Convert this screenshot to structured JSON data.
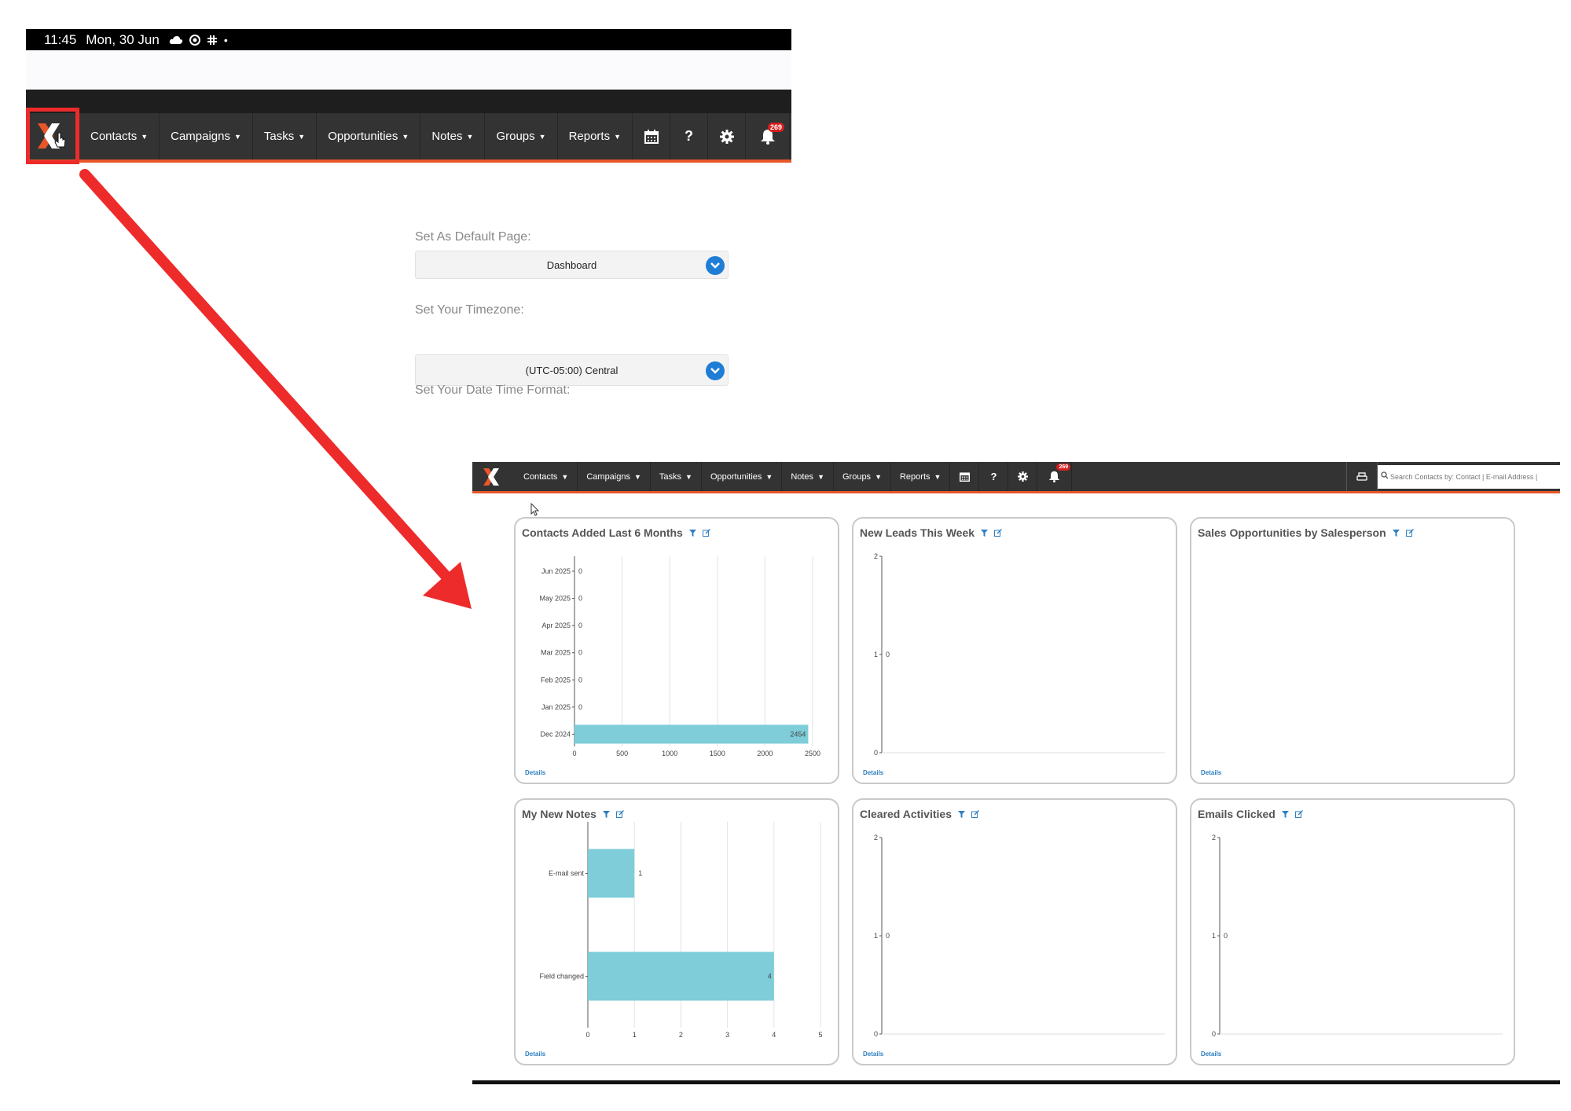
{
  "status_bar": {
    "time": "11:45",
    "date": "Mon, 30 Jun",
    "dot": "•"
  },
  "top_nav": {
    "items": [
      "Contacts",
      "Campaigns",
      "Tasks",
      "Opportunities",
      "Notes",
      "Groups",
      "Reports"
    ],
    "notification_count": "269"
  },
  "settings": {
    "default_page_label": "Set As Default Page:",
    "default_page_value": "Dashboard",
    "timezone_label": "Set Your Timezone:",
    "timezone_value": "(UTC-05:00) Central",
    "date_format_label": "Set Your Date Time Format:"
  },
  "dash_nav": {
    "items": [
      "Contacts",
      "Campaigns",
      "Tasks",
      "Opportunities",
      "Notes",
      "Groups",
      "Reports"
    ],
    "notification_count": "269",
    "search_placeholder": "Search Contacts by: Contact | E-mail Address |"
  },
  "annotation_color": "#ee2b2b",
  "accent_color": "#e8562a",
  "bar_color": "#7ecdd9",
  "details_label": "Details",
  "widgets": [
    {
      "title": "Contacts Added Last 6 Months"
    },
    {
      "title": "New Leads This Week"
    },
    {
      "title": "Sales Opportunities by Salesperson"
    },
    {
      "title": "My New Notes"
    },
    {
      "title": "Cleared Activities"
    },
    {
      "title": "Emails Clicked"
    }
  ],
  "chart_data": [
    {
      "type": "bar",
      "orientation": "horizontal",
      "categories": [
        "Jun 2025",
        "May 2025",
        "Apr 2025",
        "Mar 2025",
        "Feb 2025",
        "Jan 2025",
        "Dec 2024"
      ],
      "values": [
        0,
        0,
        0,
        0,
        0,
        0,
        2454
      ],
      "xlim": [
        0,
        2500
      ],
      "xticks": [
        0,
        500,
        1000,
        1500,
        2000,
        2500
      ],
      "grid": true
    },
    {
      "type": "bar",
      "categories": [
        "1"
      ],
      "values": [
        0
      ],
      "ylim": [
        0,
        2
      ],
      "yticks": [
        0,
        1,
        2
      ]
    },
    {
      "type": "bar",
      "categories": [],
      "values": []
    },
    {
      "type": "bar",
      "orientation": "horizontal",
      "categories": [
        "E-mail sent",
        "Field changed"
      ],
      "values": [
        1,
        4
      ],
      "xlim": [
        0,
        5
      ],
      "xticks": [
        0,
        1,
        2,
        3,
        4,
        5
      ],
      "grid": true
    },
    {
      "type": "bar",
      "categories": [
        "1"
      ],
      "values": [
        0
      ],
      "ylim": [
        0,
        2
      ],
      "yticks": [
        0,
        1,
        2
      ]
    },
    {
      "type": "bar",
      "categories": [
        "1"
      ],
      "values": [
        0
      ],
      "ylim": [
        0,
        2
      ],
      "yticks": [
        0,
        1,
        2
      ]
    }
  ]
}
